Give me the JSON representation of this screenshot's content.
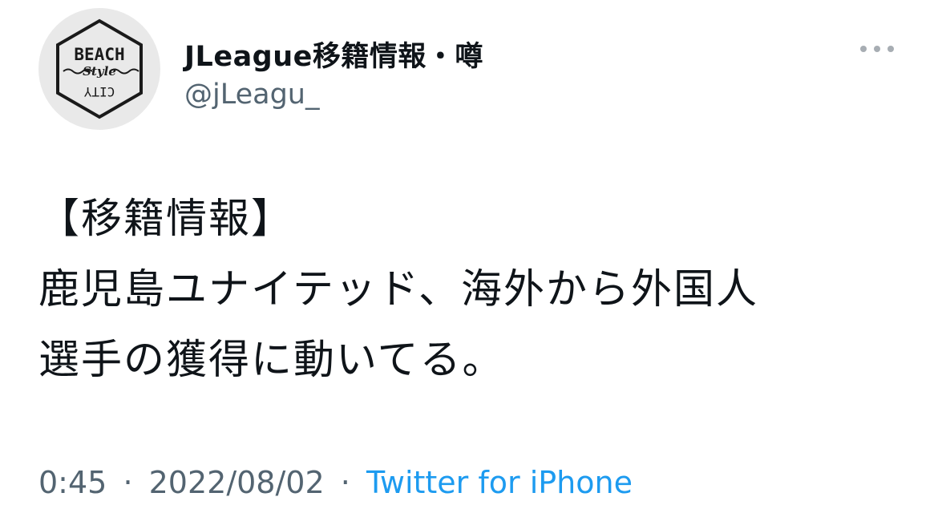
{
  "author": {
    "display_name": "JLeague移籍情報・噂",
    "handle": "@jLeagu_",
    "avatar": {
      "top_text": "BEACH",
      "middle_text": "Style",
      "bottom_text": "CITY"
    }
  },
  "icons": {
    "more": "more-horizontal-icon"
  },
  "tweet": {
    "lines": [
      "【移籍情報】",
      "鹿児島ユナイテッド、海外から外国人",
      "選手の獲得に動いてる。"
    ]
  },
  "meta": {
    "time": "0:45",
    "separator": "·",
    "date": "2022/08/02",
    "source": "Twitter for iPhone"
  },
  "colors": {
    "text": "#0f1419",
    "secondary": "#536471",
    "link": "#1d9bf0",
    "avatar_bg": "#e9e9e9"
  }
}
